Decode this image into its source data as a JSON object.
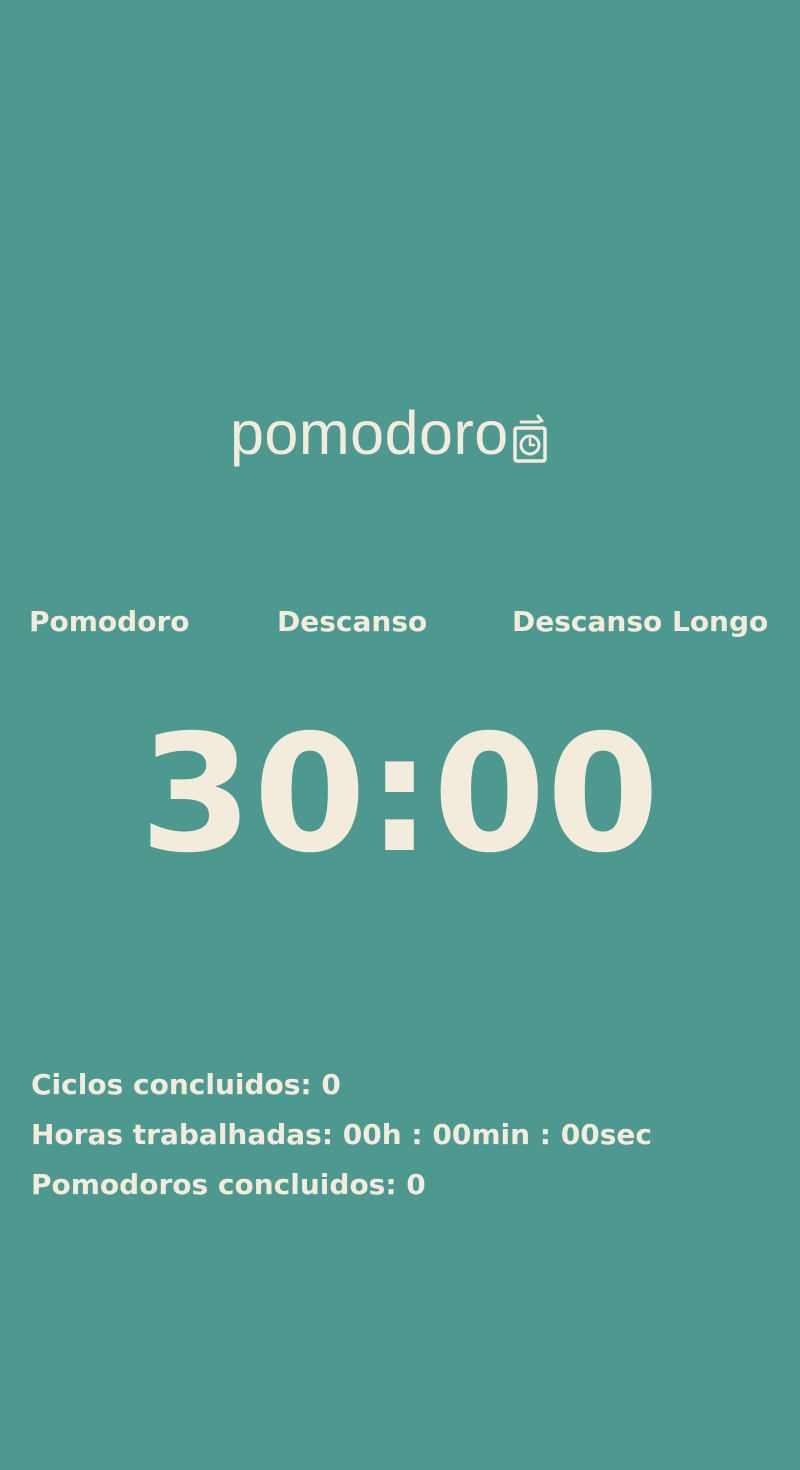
{
  "app": {
    "logo_text": "pomodoro",
    "logo_icon": "alarm-clock-icon",
    "colors": {
      "background": "#4e998f",
      "foreground": "#f3ecdc"
    }
  },
  "tabs": [
    {
      "label": "Pomodoro"
    },
    {
      "label": "Descanso"
    },
    {
      "label": "Descanso Longo"
    }
  ],
  "timer": {
    "display": "30:00"
  },
  "stats": {
    "cycles": "Ciclos concluidos: 0",
    "hours": "Horas trabalhadas: 00h : 00min : 00sec",
    "pomodoros": "Pomodoros concluidos: 0"
  }
}
